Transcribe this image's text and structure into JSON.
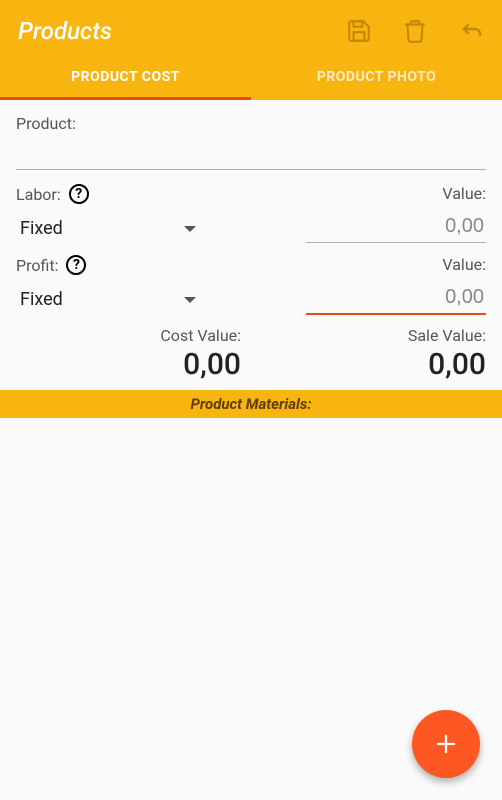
{
  "header": {
    "title": "Products"
  },
  "tabs": {
    "cost": "PRODUCT COST",
    "photo": "PRODUCT PHOTO"
  },
  "product": {
    "label": "Product:",
    "value": ""
  },
  "labor": {
    "label": "Labor:",
    "value_label": "Value:",
    "type": "Fixed",
    "value": "0,00"
  },
  "profit": {
    "label": "Profit:",
    "value_label": "Value:",
    "type": "Fixed",
    "value": "0,00"
  },
  "summary": {
    "cost_label": "Cost Value:",
    "cost_value": "0,00",
    "sale_label": "Sale Value:",
    "sale_value": "0,00"
  },
  "materials": {
    "header": "Product Materials:"
  },
  "icons": {
    "help": "?"
  }
}
